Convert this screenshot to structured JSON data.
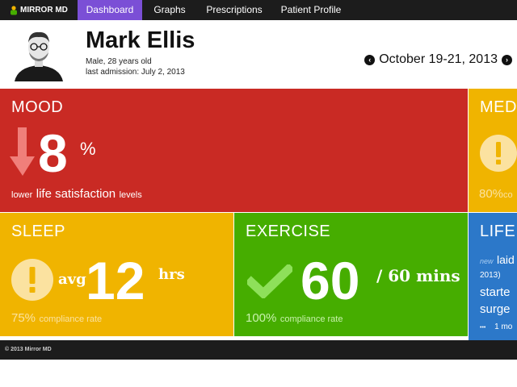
{
  "nav": {
    "brand": "MIRROR MD",
    "items": [
      {
        "label": "Dashboard",
        "active": true
      },
      {
        "label": "Graphs",
        "active": false
      },
      {
        "label": "Prescriptions",
        "active": false
      },
      {
        "label": "Patient Profile",
        "active": false
      }
    ]
  },
  "patient": {
    "name": "Mark Ellis",
    "demographics": "Male, 28 years old",
    "last_admission": "last admission: July 2, 2013"
  },
  "date_range": "October 19-21, 2013",
  "mood": {
    "title": "MOOD",
    "icon": "arrow-down-icon",
    "value": "8",
    "unit": "%",
    "caption_pre": "lower",
    "caption_main": "life satisfaction",
    "caption_post": "levels",
    "color": "#c92a24"
  },
  "med": {
    "title": "MED",
    "icon": "exclamation-circle-icon",
    "caption_value": "80%",
    "caption_rest": "co",
    "color": "#f0b400"
  },
  "sleep": {
    "title": "SLEEP",
    "icon": "exclamation-circle-icon",
    "prefix": "avg",
    "value": "12",
    "unit": "hrs",
    "caption_value": "75%",
    "caption_rest": "compliance rate",
    "color": "#f0b400"
  },
  "exercise": {
    "title": "EXERCISE",
    "icon": "checkmark-icon",
    "value": "60",
    "unit": "/ 60 mins",
    "caption_value": "100%",
    "caption_rest": "compliance rate",
    "color": "#46ad00"
  },
  "life": {
    "title": "LIFE",
    "tag": "new",
    "line1": "laid",
    "line2": "2013)",
    "line3": "starte",
    "line4": "surge",
    "more_dots": "•••",
    "more_text": "1 mo",
    "color": "#2c78c9"
  },
  "footer": "© 2013 Mirror MD"
}
